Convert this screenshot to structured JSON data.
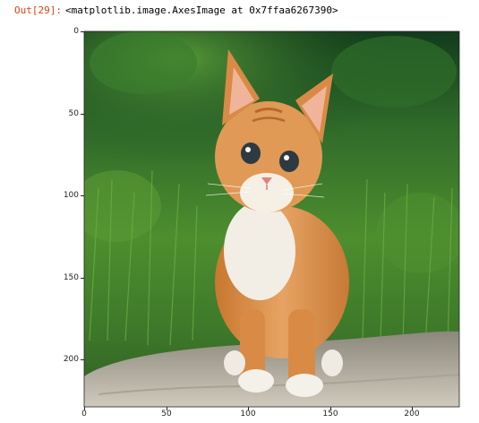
{
  "output_prompt": "Out[29]:",
  "output_repr": "<matplotlib.image.AxesImage at 0x7ffaa6267390>",
  "axes": {
    "image_subject": "photo of an orange tabby kitten sitting on a rock in front of green grass",
    "y_ticks": [
      "0",
      "50",
      "100",
      "150",
      "200"
    ],
    "x_ticks": [
      "0",
      "50",
      "100",
      "150",
      "200"
    ]
  }
}
